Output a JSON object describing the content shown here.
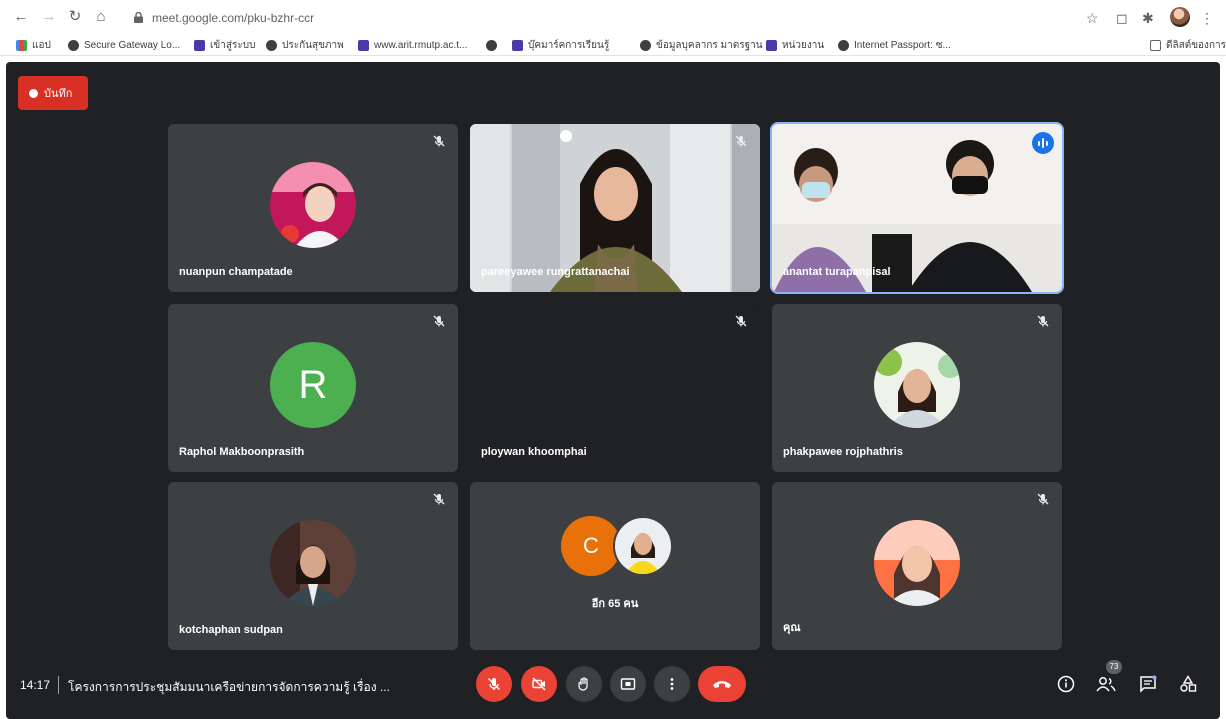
{
  "browser": {
    "url": "meet.google.com/pku-bzhr-ccr",
    "bookmarks": [
      {
        "label": "แอป",
        "icon": "apps-grid-icon"
      },
      {
        "label": "Secure Gateway Lo...",
        "icon": "globe-icon"
      },
      {
        "label": "เข้าสู่ระบบ",
        "icon": "bookmark-icon"
      },
      {
        "label": "ประกันสุขภาพ",
        "icon": "globe-icon"
      },
      {
        "label": "www.arit.rmutp.ac.t...",
        "icon": "bookmark-icon"
      },
      {
        "label": "",
        "icon": "globe-icon"
      },
      {
        "label": "บุ๊คมาร์คการเรียนรู้",
        "icon": "bookmark-icon"
      },
      {
        "label": "ข้อมูลบุคลากร มาตรฐาน",
        "icon": "globe-icon"
      },
      {
        "label": "หน่วยงาน",
        "icon": "bookmark-icon"
      },
      {
        "label": "Internet Passport: ซ...",
        "icon": "globe-icon"
      }
    ],
    "reading_list": "ดีลิสต์ของการ"
  },
  "meet": {
    "record_label": "บันทึก",
    "participants": [
      {
        "name": "nuanpun champatade",
        "muted": true
      },
      {
        "name": "pareeyawee rungrattanachai",
        "muted": true
      },
      {
        "name": "anantat turapanpisal",
        "muted": false,
        "speaking": true
      },
      {
        "name": "Raphol Makboonprasith",
        "muted": true,
        "initial": "R"
      },
      {
        "name": "ploywan khoomphai",
        "muted": true
      },
      {
        "name": "phakpawee rojphathris",
        "muted": true
      },
      {
        "name": "kotchaphan sudpan",
        "muted": true
      },
      {
        "name": "",
        "muted": false,
        "group": true
      },
      {
        "name": "คุณ",
        "muted": true
      }
    ],
    "group_tile": {
      "initial": "C",
      "others_label": "อีก 65 คน"
    },
    "bottom": {
      "time": "14:17",
      "meeting_title": "โครงการการประชุมสัมมนาเครือข่ายการจัดการความรู้ เรื่อง ...",
      "people_count": "73"
    }
  },
  "colors": {
    "stage_bg": "#1f2124",
    "tile_bg": "#3c4043",
    "accent_red": "#ea4335",
    "speaking_blue": "#1a73e8",
    "avatar_green": "#4caf50",
    "avatar_orange": "#e8710a"
  }
}
